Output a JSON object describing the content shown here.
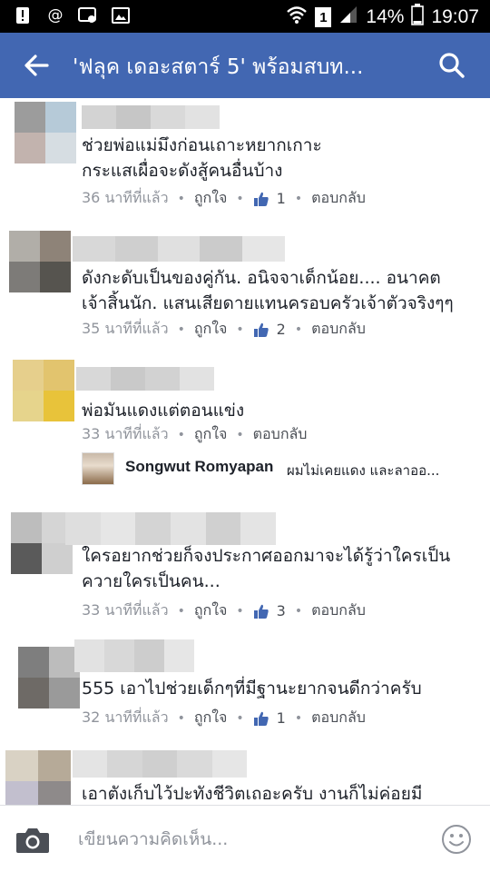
{
  "status_bar": {
    "sim_number": "1",
    "battery_percent": "14%",
    "time": "19:07"
  },
  "app_bar": {
    "title": "'ฟลุค เดอะสตาร์ 5' พร้อมสบท...",
    "back_icon": "arrow-left-icon",
    "search_icon": "search-icon"
  },
  "comments": [
    {
      "lines": [
        "ช่วยพ่อแม่มึงก่อนเถาะหยากเกาะ",
        "กระแสเผื่อจะดังสู้คนอื่นบ้าง"
      ],
      "time": "36 นาทีที่แล้ว",
      "like_label": "ถูกใจ",
      "like_count": "1",
      "reply_label": "ตอบกลับ"
    },
    {
      "lines": [
        "ดังกะดับเป็นของคู่กัน. อนิจจาเด็กน้อย.... อนาคต",
        "เจ้าสิ้นนัก. แสนเสียดายแทนครอบครัวเจ้าตัวจริงๆๆ"
      ],
      "time": "35 นาทีที่แล้ว",
      "like_label": "ถูกใจ",
      "like_count": "2",
      "reply_label": "ตอบกลับ"
    },
    {
      "lines": [
        "พ่อมันแดงแต่ตอนแข่ง"
      ],
      "time": "33 นาทีที่แล้ว",
      "like_label": "ถูกใจ",
      "like_count": "",
      "reply_label": "ตอบกลับ"
    },
    {
      "lines": [
        "ใครอยากช่วยก็จงประกาศออกมาจะได้รู้ว่าใครเป็น",
        "ควายใครเป็นคน..."
      ],
      "time": "33 นาทีที่แล้ว",
      "like_label": "ถูกใจ",
      "like_count": "3",
      "reply_label": "ตอบกลับ"
    },
    {
      "lines": [
        "555 เอาไปช่วยเด็กๆที่มีฐานะยากจนดีกว่าครับ"
      ],
      "time": "32 นาทีที่แล้ว",
      "like_label": "ถูกใจ",
      "like_count": "1",
      "reply_label": "ตอบกลับ"
    },
    {
      "lines": [
        "เอาตังเก็บไว้ปะทังชีวิตเถอะครับ งานก็ไม่ค่อยมี"
      ],
      "time": "",
      "like_label": "",
      "like_count": "",
      "reply_label": ""
    }
  ],
  "reply_preview": {
    "name": "Songwut Romyapan",
    "text": "ผมไม่เคยแดง และลาออ..."
  },
  "composer": {
    "placeholder": "เขียนความคิดเห็น...",
    "camera_icon": "camera-icon",
    "emoji_icon": "smiley-icon"
  },
  "colors": {
    "app_bar": "#4267b2",
    "status_bar": "#000000",
    "meta_text": "#90949c"
  }
}
